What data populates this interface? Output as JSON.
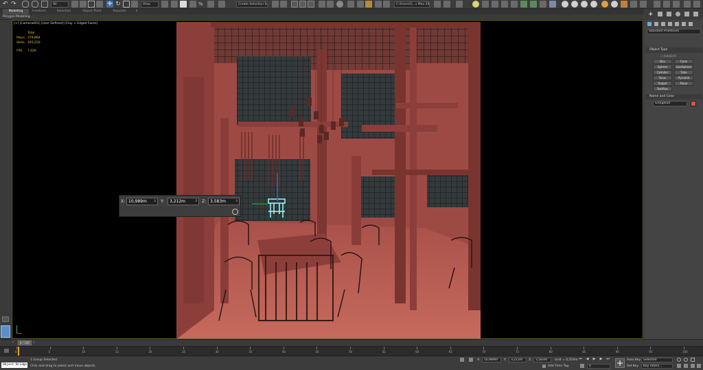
{
  "toolbar": {
    "view_dropdown": "View",
    "selection_set_dropdown": "Create Selection Se",
    "window_title": "C:\\Users\\G...s Max 2020",
    "icons": [
      "undo-icon",
      "redo-icon",
      "link-icon",
      "unlink-icon",
      "bind-space-warp-icon",
      "select-object-icon",
      "select-by-name-icon",
      "rect-selection-icon",
      "window-crossing-icon",
      "select-move-icon",
      "select-rotate-icon",
      "select-scale-icon",
      "placement-icon",
      "reference-coord-icon",
      "pivot-icon",
      "snap-icon",
      "angle-snap-icon",
      "percent-snap-icon",
      "spinner-snap-icon",
      "mirror-icon",
      "align-icon",
      "layer-explorer-icon",
      "scene-explorer-icon",
      "curve-editor-icon",
      "schematic-icon",
      "material-editor-icon",
      "render-setup-icon",
      "render-frame-icon",
      "render-icon"
    ]
  },
  "ribbon": {
    "tabs": [
      "Modeling",
      "Freeform",
      "Selection",
      "Object Paint",
      "Populate"
    ],
    "active_tab": "Modeling",
    "sub_label": "Polygon Modeling"
  },
  "viewport": {
    "label": "[+] [Camera001] [User Defined] [Clay + Edged Faces]",
    "stats": {
      "total_label": "Total",
      "polys_label": "Polys:",
      "polys_value": "379,864",
      "verts_label": "Verts:",
      "verts_value": "293,250",
      "fps_label": "FPS:",
      "fps_value": "7.026"
    },
    "scene_color": "#9e4a44"
  },
  "typein": {
    "x_label": "X:",
    "x_value": "10,989m",
    "y_label": "Y:",
    "y_value": "3,212m",
    "z_label": "Z:",
    "z_value": "3,583m"
  },
  "command_panel": {
    "category_dropdown": "Standard Primitives",
    "object_type_header": "Object Type",
    "autogrid_label": "AutoGrid",
    "buttons": [
      "Box",
      "Cone",
      "Sphere",
      "GeoSphere",
      "Cylinder",
      "Tube",
      "Torus",
      "Pyramid",
      "Teapot",
      "Plane",
      "TextPlus"
    ],
    "name_color_header": "Name and Color",
    "name_value": "Group010",
    "object_color": "#d9534f"
  },
  "timeline": {
    "frame_display": "0 / 100",
    "ticks": [
      "0",
      "5",
      "10",
      "15",
      "20",
      "25",
      "30",
      "35",
      "40",
      "45",
      "50",
      "55",
      "60",
      "65",
      "70",
      "75",
      "80",
      "85",
      "90",
      "95",
      "100"
    ]
  },
  "status": {
    "maxscript_label": "Object Bridge",
    "selection_status": "1 Group Selected",
    "prompt": "Click and drag to select and move objects",
    "x_label": "X:",
    "x_value": "10,989m",
    "y_label": "Y:",
    "y_value": "3,212m",
    "z_label": "Z:",
    "z_value": "3,583m",
    "grid": "Grid = 0,254m",
    "add_time_tag": "Add Time Tag",
    "auto_key": "Auto Key",
    "auto_key_mode": "Selected",
    "set_key": "Set Key",
    "key_filters": "Key Filters...",
    "frame_value": "0"
  }
}
